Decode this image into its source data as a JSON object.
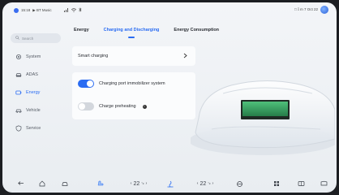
{
  "statusbar": {
    "time": "15:18",
    "media": "▶ BT Music",
    "right_text": "□ 𝕀 m 7 Oct 22"
  },
  "search": {
    "placeholder": "Search"
  },
  "sidebar": {
    "items": [
      {
        "label": "System",
        "icon": "gear-icon"
      },
      {
        "label": "ADAS",
        "icon": "car-adas-icon"
      },
      {
        "label": "Energy",
        "icon": "battery-icon",
        "active": true
      },
      {
        "label": "Vehicle",
        "icon": "vehicle-icon"
      },
      {
        "label": "Service",
        "icon": "shield-icon"
      }
    ]
  },
  "tabs": [
    {
      "label": "Energy"
    },
    {
      "label": "Charging and Discharging",
      "active": true
    },
    {
      "label": "Energy Consumption"
    }
  ],
  "settings": {
    "smart_charging": "Smart charging",
    "immobilizer": {
      "label": "Charging port immobilizer system",
      "on": true
    },
    "preheating": {
      "label": "Charge preheating",
      "on": false
    }
  },
  "dock": {
    "left_temp": "22",
    "left_temp_unit": "°c",
    "right_temp": "22",
    "right_temp_unit": "°c",
    "prev": "‹",
    "next": "›"
  },
  "colors": {
    "accent": "#2a6cf2",
    "battery": "#2e9a5c"
  }
}
